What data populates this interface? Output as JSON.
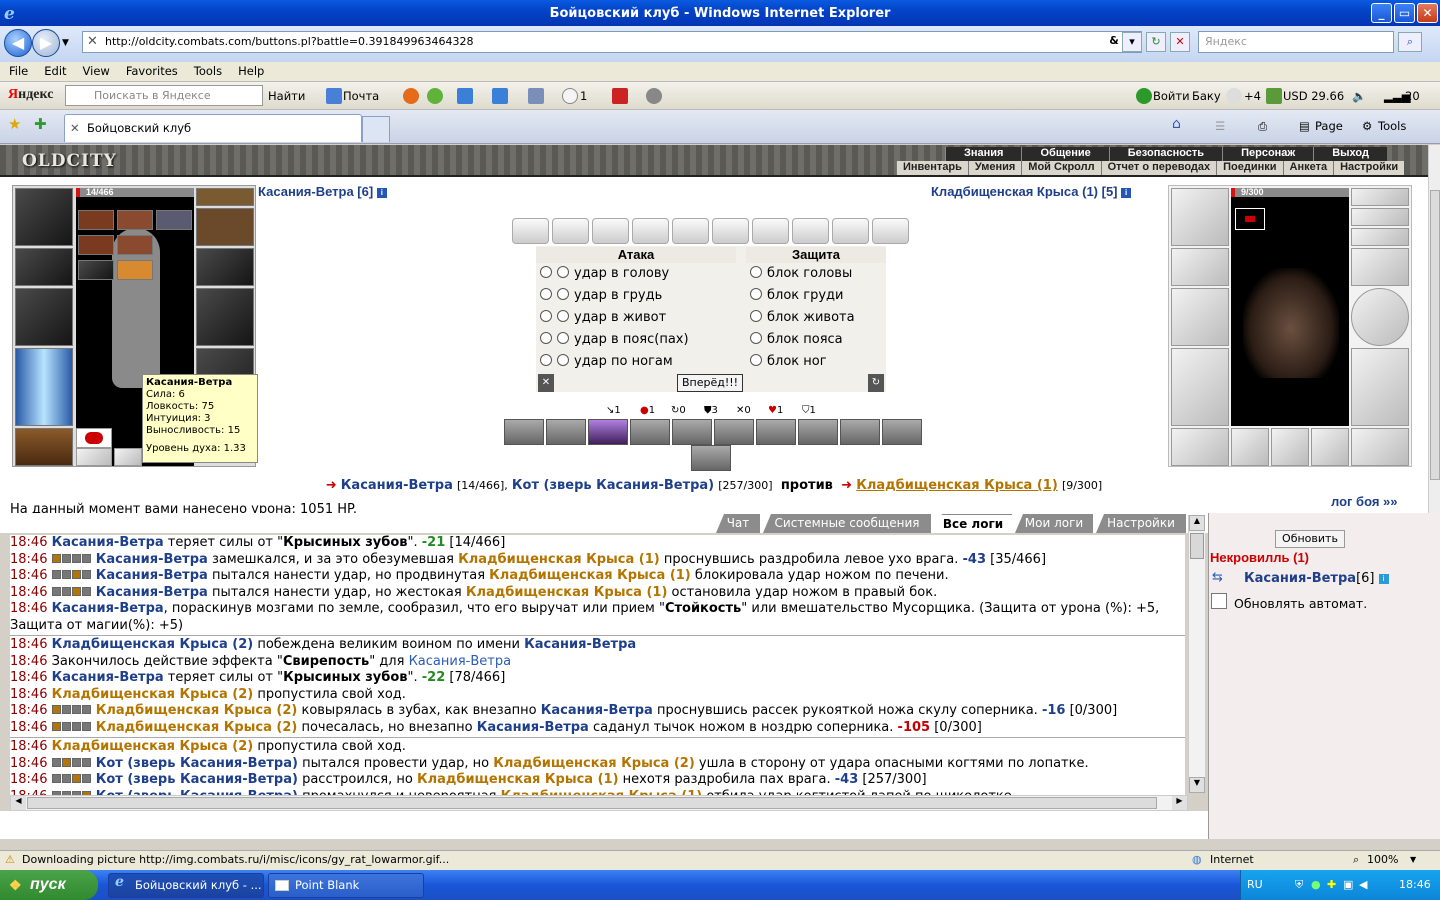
{
  "window": {
    "title": "Бойцовский клуб - Windows Internet Explorer"
  },
  "address": {
    "url": "http://oldcity.combats.com/buttons.pl?battle=0.391849963464328",
    "search_placeholder": "Яндекс"
  },
  "menu": [
    "File",
    "Edit",
    "View",
    "Favorites",
    "Tools",
    "Help"
  ],
  "yandex": {
    "logo_first": "Я",
    "logo_rest": "ндекс",
    "search_placeholder": "Поискать в Яндексе",
    "find": "Найти",
    "mail": "Почта",
    "reply_count": "1",
    "login": "Войти",
    "city": "Баку",
    "weather": "+4",
    "currency": "USD 29.66",
    "volume": "20"
  },
  "tab": {
    "label": "Бойцовский клуб",
    "page": "Page",
    "tools": "Tools"
  },
  "game": {
    "logo": "OLDCITY",
    "nav_top": [
      "Знания",
      "Общение",
      "Безопасность",
      "Персонаж",
      "Выход"
    ],
    "nav_bottom": [
      "Инвентарь",
      "Умения",
      "Мой Скролл",
      "Отчет о переводах",
      "Поединки",
      "Анкета",
      "Настройки"
    ],
    "player": {
      "name": "Касания-Ветра [6]",
      "hp": "14/466",
      "hp_fraction": 0.03
    },
    "enemy": {
      "name": "Кладбищенская Крыса (1) [5]",
      "hp": "9/300",
      "hp_fraction": 0.03
    },
    "tooltip": {
      "name": "Касания-Ветра",
      "str": "Сила: 6",
      "agi": "Ловкость: 75",
      "intu": "Интуиция: 3",
      "end": "Выносливость: 15",
      "spirit": "Уровень духа: 1.33"
    },
    "attack_title": "Атака",
    "defense_title": "Защита",
    "attacks": [
      "удар в голову",
      "удар в грудь",
      "удар в живот",
      "удар в пояс(пах)",
      "удар по ногам"
    ],
    "defenses": [
      "блок головы",
      "блок груди",
      "блок живота",
      "блок пояса",
      "блок ног"
    ],
    "forward": "Вперёд!!!",
    "counters": [
      "1",
      "1",
      "0",
      "3",
      "0",
      "1",
      "1"
    ],
    "versus": {
      "p1": "Касания-Ветра",
      "p1hp": "[14/466],",
      "pet": "Кот (зверь Касания-Ветра)",
      "pethp": "[257/300]",
      "vs": "против",
      "e1": "Кладбищенская Крыса (1)",
      "e1hp": "[9/300]"
    },
    "damage_line": "На данный момент вами нанесено урона: 1051 HP.",
    "battle_log": "лог боя »»"
  },
  "log": {
    "tabs": [
      "Чат",
      "Системные сообщения",
      "Все логи",
      "Мои логи",
      "Настройки"
    ],
    "active_tab": "Все логи",
    "lines": [
      {
        "time": "18:46",
        "html": "<span class='blue'>Касания-Ветра</span> теряет силы от \"<b>Крысиных зубов</b>\". <span class='grn'>-21</span> [14/466]"
      },
      {
        "time": "18:46",
        "icons": "fbbb",
        "html": "<span class='blue'>Касания-Ветра</span> замешкался, и за это обезумевшая <span class='orange'>Кладбищенская Крыса (1)</span> проснувшись раздробила левое ухо врага. <span class='negb'>-43</span> [35/466]"
      },
      {
        "time": "18:46",
        "icons": "bbfb",
        "html": "<span class='blue'>Касания-Ветра</span> пытался нанести удар, но продвинутая <span class='orange'>Кладбищенская Крыса (1)</span> блокировала удар ножом по печени."
      },
      {
        "time": "18:46",
        "icons": "bbfb",
        "html": "<span class='blue'>Касания-Ветра</span> пытался нанести удар, но жестокая <span class='orange'>Кладбищенская Крыса (1)</span> остановила удар ножом в правый бок."
      },
      {
        "time": "18:46",
        "html": "<span class='blue'>Касания-Ветра</span>, пораскинув мозгами по земле, сообразил, что его выручат или прием \"<b>Стойкость</b>\" или вмешательство Мусорщика. (Защита от урона (%): +5,"
      },
      {
        "time": "",
        "html": "Защита от магии(%): +5)"
      },
      {
        "sep": true
      },
      {
        "time": "18:46",
        "html": "<span class='blue'>Кладбищенская Крыса (2)</span> побеждена великим воином по имени <span class='blue'>Касания-Ветра</span>"
      },
      {
        "time": "18:46",
        "html": "Закончилось действие эффекта \"<b>Свирепость</b>\" для <span class='blue' style='font-weight:normal;color:#2a5bb5'>Касания-Ветра</span>"
      },
      {
        "time": "18:46",
        "html": "<span class='blue'>Касания-Ветра</span> теряет силы от \"<b>Крысиных зубов</b>\". <span class='grn'>-22</span> [78/466]"
      },
      {
        "time": "18:46",
        "html": "<span class='orange'>Кладбищенская Крыса (2)</span> пропустила свой ход."
      },
      {
        "time": "18:46",
        "icons": "fbbb",
        "html": "<span class='orange'>Кладбищенская Крыса (2)</span> ковырялась в зубах, как внезапно <span class='blue'>Касания-Ветра</span> проснувшись рассек рукояткой ножа скулу соперника. <span class='negb'>-16</span> [0/300]"
      },
      {
        "time": "18:46",
        "icons": "fbbb",
        "html": "<span class='orange'>Кладбищенская Крыса (2)</span> почесалась, но внезапно <span class='blue'>Касания-Ветра</span> саданул тычок ножом в ноздрю соперника. <span class='neg'>-105</span> [0/300]"
      },
      {
        "sep": true
      },
      {
        "time": "18:46",
        "html": "<span class='orange'>Кладбищенская Крыса (2)</span> пропустила свой ход."
      },
      {
        "time": "18:46",
        "icons": "bfbb",
        "html": "<span class='blue'>Кот (зверь Касания-Ветра)</span> пытался провести удар, но <span class='orange'>Кладбищенская Крыса (2)</span> ушла в сторону от удара опасными когтями по лопатке."
      },
      {
        "time": "18:46",
        "icons": "bbfb",
        "html": "<span class='blue'>Кот (зверь Касания-Ветра)</span> расстроился, но <span class='orange'>Кладбищенская Крыса (1)</span> нехотя раздробила пах врага. <span class='negb'>-43</span> [257/300]"
      },
      {
        "time": "18:46",
        "icons": "bbbf",
        "html": "<span class='blue'>Кот (зверь Касания-Ветра)</span> промахнулся и невероятная <span class='orange'>Кладбищенская Крыса (1)</span> отбила удар когтистой лапой по щиколотке."
      }
    ]
  },
  "side": {
    "refresh": "Обновить",
    "location": "Некровилль (1)",
    "member": "Касания-Ветра",
    "member_level": "[6]",
    "auto": "Обновлять автомат."
  },
  "status": {
    "text": "Downloading picture http://img.combats.ru/i/misc/icons/gy_rat_lowarmor.gif...",
    "zone": "Internet",
    "zoom": "100%"
  },
  "taskbar": {
    "start": "пуск",
    "items": [
      "Бойцовский клуб - ...",
      "Point Blank"
    ],
    "lang": "RU",
    "clock": "18:46"
  }
}
